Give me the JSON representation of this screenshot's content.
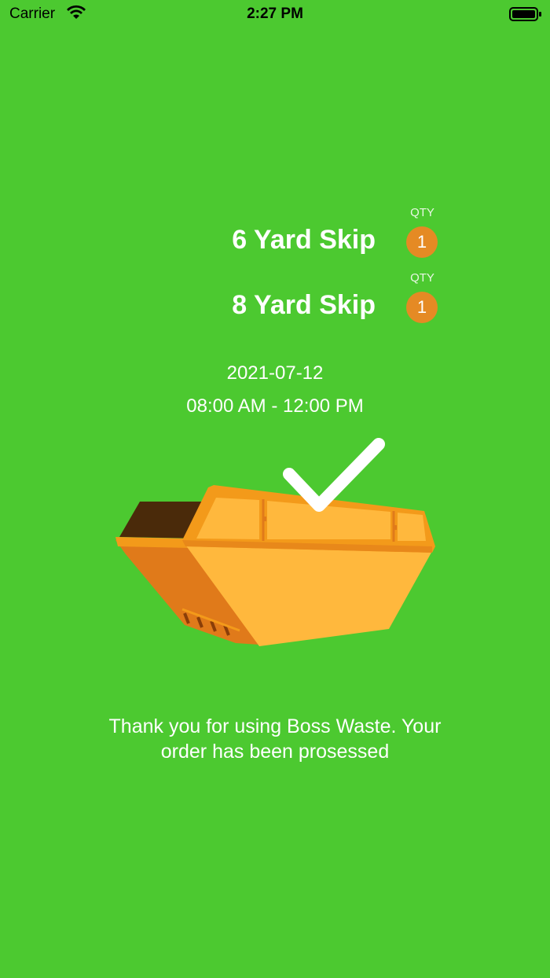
{
  "status_bar": {
    "carrier": "Carrier",
    "time": "2:27 PM"
  },
  "order": {
    "items": [
      {
        "name": "6 Yard Skip",
        "qty_label": "QTY",
        "qty": "1"
      },
      {
        "name": "8 Yard Skip",
        "qty_label": "QTY",
        "qty": "1"
      }
    ],
    "date": "2021-07-12",
    "time_slot": "08:00 AM - 12:00 PM"
  },
  "confirmation": {
    "message": "Thank you for using Boss Waste. Your order has been prosessed"
  },
  "colors": {
    "background": "#4cc930",
    "badge": "#e58a24",
    "skip_body": "#ffb83d",
    "skip_frame": "#f39a1a",
    "skip_side": "#e07a1a"
  },
  "icons": [
    "wifi-icon",
    "battery-icon",
    "checkmark-icon",
    "skip-bin-icon"
  ]
}
